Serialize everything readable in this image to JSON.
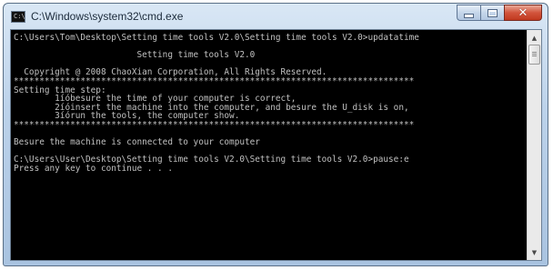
{
  "window": {
    "title": "C:\\Windows\\system32\\cmd.exe",
    "icon_name": "cmd-icon",
    "icon_text": "C:\\",
    "controls": {
      "minimize": "minimize-icon",
      "maximize": "maximize-icon",
      "close": "close-icon",
      "close_glyph": "✕"
    }
  },
  "console": {
    "background": "#000000",
    "foreground": "#c0c0c0",
    "lines": [
      "C:\\Users\\Tom\\Desktop\\Setting time tools V2.0\\Setting time tools V2.0>updatatime",
      "",
      "                        Setting time tools V2.0",
      "",
      "  Copyright @ 2008 ChaoXian Corporation, All Rights Reserved.",
      "******************************************************************************",
      "Setting time step:",
      "        1íóbesure the time of your computer is correct,",
      "        2íóinsert the machine into the computer, and besure the U_disk is on,",
      "        3íórun the tools, the computer show.",
      "******************************************************************************",
      "",
      "Besure the machine is connected to your computer",
      "",
      "C:\\Users\\User\\Desktop\\Setting time tools V2.0\\Setting time tools V2.0>pause:e",
      "Press any key to continue . . ."
    ]
  },
  "scrollbar": {
    "up_arrow": "▲",
    "down_arrow": "▼"
  }
}
